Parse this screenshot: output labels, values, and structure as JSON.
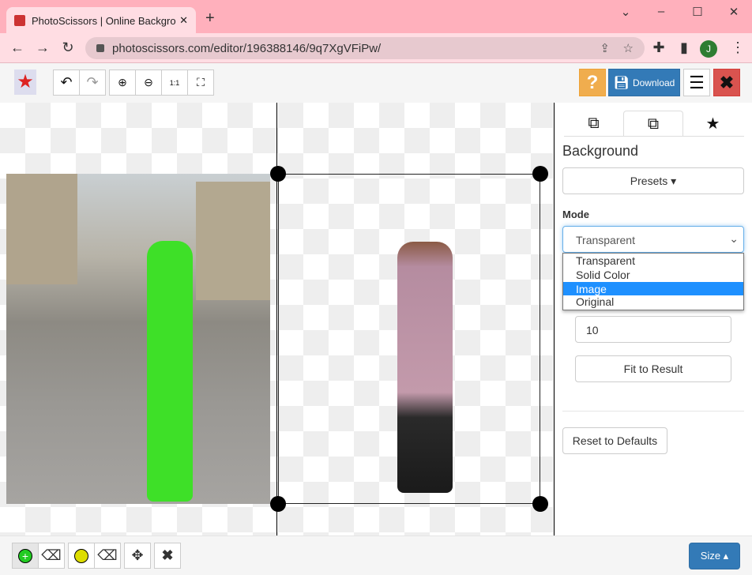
{
  "browser": {
    "tab_title": "PhotoScissors | Online Backgro",
    "url": "photoscissors.com/editor/196388146/9q7XgVFiPw/",
    "profile_initial": "J"
  },
  "toolbar": {
    "download_label": "Download",
    "help_label": "?"
  },
  "panel": {
    "heading": "Background",
    "presets_label": "Presets ▾",
    "mode_label": "Mode",
    "mode_selected": "Transparent",
    "mode_options": [
      "Transparent",
      "Solid Color",
      "Image",
      "Original"
    ],
    "highlighted_option": "Image",
    "blur_value": "10",
    "fit_label": "Fit to Result",
    "reset_label": "Reset to Defaults"
  },
  "bottom": {
    "size_label": "Size ▴"
  },
  "colors": {
    "accent": "#337ab7",
    "help": "#f0ad4e",
    "close": "#d9534f",
    "highlight": "#1e90ff",
    "foreground_mark": "#22cc22",
    "background_mark": "#dddd00"
  }
}
